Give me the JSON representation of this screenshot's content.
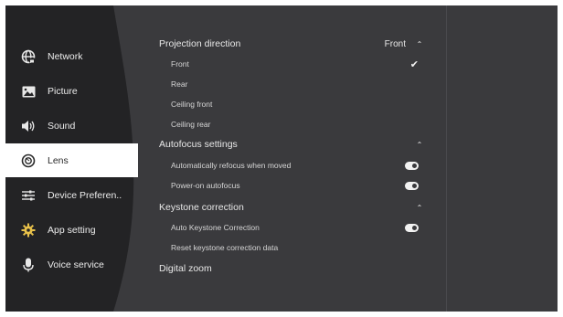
{
  "sidebar": {
    "items": [
      {
        "label": "Network",
        "icon": "globe-icon"
      },
      {
        "label": "Picture",
        "icon": "picture-icon"
      },
      {
        "label": "Sound",
        "icon": "sound-icon"
      },
      {
        "label": "Lens",
        "icon": "lens-icon",
        "active": true
      },
      {
        "label": "Device Preferen..",
        "icon": "sliders-icon"
      },
      {
        "label": "App setting",
        "icon": "gear-icon"
      },
      {
        "label": "Voice service",
        "icon": "microphone-icon"
      }
    ]
  },
  "settings": {
    "projection": {
      "title": "Projection direction",
      "value": "Front",
      "options": [
        "Front",
        "Rear",
        "Ceiling front",
        "Ceiling rear"
      ],
      "selected": "Front"
    },
    "autofocus": {
      "title": "Autofocus settings",
      "options": [
        "Automatically refocus when moved",
        "Power-on autofocus"
      ],
      "toggles": [
        true,
        true
      ]
    },
    "keystone": {
      "title": "Keystone correction",
      "options": [
        "Auto Keystone Correction",
        "Reset keystone correction data"
      ],
      "auto_toggle": true
    },
    "digital_zoom": {
      "title": "Digital zoom"
    }
  },
  "colors": {
    "background": "#3a3a3d",
    "sidebar": "#232325",
    "active_item": "#ffffff",
    "text": "#e8e8e8"
  }
}
